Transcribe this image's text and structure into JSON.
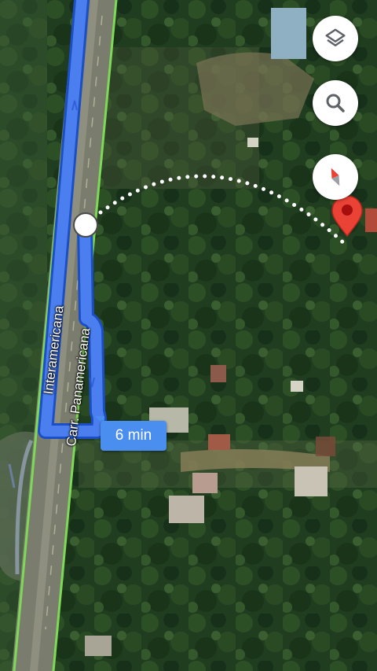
{
  "map": {
    "view": "satellite",
    "route_color": "#4b7ff0",
    "route_outline_color": "#1d4fc4",
    "walking_path_color": "#ffffff",
    "destination_pin_color": "#ea4335",
    "road_edge_color": "#7ed957"
  },
  "road_labels": [
    "Interamericana",
    "Carr. Panamericana"
  ],
  "eta": "6 min",
  "controls": {
    "layers_icon": "layers-icon",
    "search_icon": "search-icon",
    "compass_icon": "compass-icon"
  }
}
